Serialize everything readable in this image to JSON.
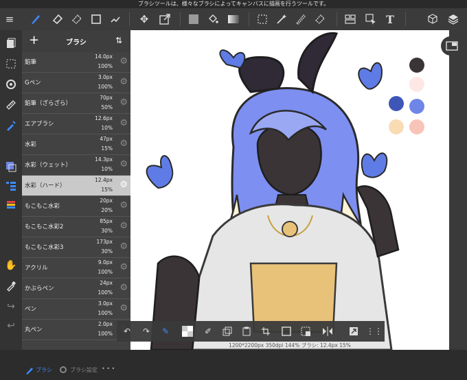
{
  "status_message": "ブラシツールは、様々なブラシによってキャンバスに描画を行うツールです。",
  "brush_panel": {
    "title": "ブラシ",
    "add_label": "+",
    "sort_label": "⇅",
    "items": [
      {
        "name": "鉛筆",
        "size": "14.0px",
        "opacity": "100%"
      },
      {
        "name": "Gペン",
        "size": "3.0px",
        "opacity": "100%"
      },
      {
        "name": "鉛筆（ざらざら）",
        "size": "70px",
        "opacity": "50%"
      },
      {
        "name": "エアブラシ",
        "size": "12.6px",
        "opacity": "10%"
      },
      {
        "name": "水彩",
        "size": "47px",
        "opacity": "15%"
      },
      {
        "name": "水彩（ウェット）",
        "size": "14.3px",
        "opacity": "10%"
      },
      {
        "name": "水彩（ハード）",
        "size": "12.4px",
        "opacity": "15%"
      },
      {
        "name": "もこもこ水彩",
        "size": "20px",
        "opacity": "20%"
      },
      {
        "name": "もこもこ水彩2",
        "size": "85px",
        "opacity": "30%"
      },
      {
        "name": "もこもこ水彩3",
        "size": "173px",
        "opacity": "30%"
      },
      {
        "name": "アクリル",
        "size": "9.0px",
        "opacity": "100%"
      },
      {
        "name": "かぶらペン",
        "size": "24px",
        "opacity": "100%"
      },
      {
        "name": "ペン",
        "size": "3.0px",
        "opacity": "100%"
      },
      {
        "name": "丸ペン",
        "size": "2.0px",
        "opacity": "100%"
      }
    ],
    "footer_brush_label": "ブラシ",
    "footer_settings_label": "ブラシ設定",
    "footer_more_label": "• • •"
  },
  "canvas_info": "1200*2200px 350dpi 144% ブラシ: 12.4px 15%",
  "palette": [
    "#3a3437",
    "#fde8e6",
    "#3e56b8",
    "#6f86e8",
    "#f9dcb4",
    "#f8c4b8"
  ],
  "icons": {
    "menu": "menu-icon",
    "brush": "brush-icon",
    "eraser": "eraser-icon",
    "layers": "layers-icon",
    "text": "text-icon"
  },
  "accent_color": "#3d8bff"
}
